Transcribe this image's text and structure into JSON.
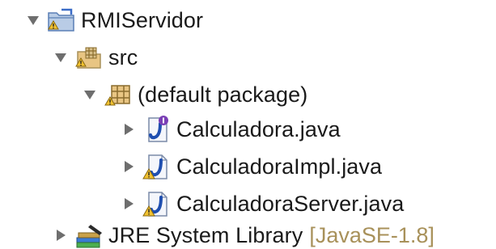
{
  "colors": {
    "text": "#1a1a1a",
    "twisty": "#6e6e6e",
    "decoration": "#a8915a",
    "warning": "#f2c230",
    "java_file": "#1f4fb0",
    "interface_badge": "#7a3fb5"
  },
  "project_tree": {
    "project": {
      "label": "RMIServidor",
      "icon": "java-project-icon",
      "expanded": true
    },
    "source_folder": {
      "label": "src",
      "icon": "source-folder-icon",
      "expanded": true
    },
    "package": {
      "label": "(default package)",
      "icon": "package-icon",
      "expanded": true
    },
    "files": [
      {
        "label": "Calculadora.java",
        "icon": "java-interface-icon",
        "expanded": false
      },
      {
        "label": "CalculadoraImpl.java",
        "icon": "java-class-warning-icon",
        "expanded": false
      },
      {
        "label": "CalculadoraServer.java",
        "icon": "java-class-warning-icon",
        "expanded": false
      }
    ],
    "library": {
      "label": "JRE System Library",
      "suffix": "[JavaSE-1.8]",
      "icon": "library-icon",
      "expanded": false
    }
  }
}
